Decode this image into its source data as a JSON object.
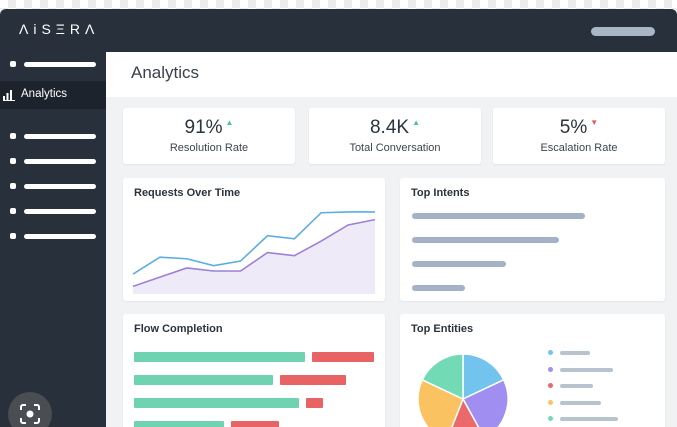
{
  "brand": {
    "logo": "ΛiSΞRΛ"
  },
  "sidebar": {
    "active_label": "Analytics",
    "icon": "bar-chart-icon"
  },
  "page": {
    "title": "Analytics"
  },
  "kpis": [
    {
      "value": "91%",
      "label": "Resolution Rate",
      "trend": "up",
      "trend_color": "#3ec7a0"
    },
    {
      "value": "8.4K",
      "label": "Total Conversation",
      "trend": "up",
      "trend_color": "#3ec7a0"
    },
    {
      "value": "5%",
      "label": "Escalation Rate",
      "trend": "down",
      "trend_color": "#e85a5a"
    }
  ],
  "cards": {
    "requests_title": "Requests Over Time",
    "intents_title": "Top Intents",
    "flow_title": "Flow Completion",
    "entities_title": "Top Entities"
  },
  "chart_data": [
    {
      "type": "line",
      "title": "Requests Over Time",
      "x": [
        1,
        2,
        3,
        4,
        5,
        6,
        7,
        8,
        9,
        10
      ],
      "series": [
        {
          "color": "#5aaee0",
          "values": [
            26,
            48,
            46,
            37,
            43,
            76,
            72,
            106,
            107,
            107
          ]
        },
        {
          "color": "#9c80d8",
          "values": [
            10,
            22,
            34,
            30,
            30,
            54,
            50,
            69,
            90,
            97
          ]
        }
      ],
      "ylim": [
        0,
        120
      ],
      "area_fill": "#efeaf8"
    },
    {
      "type": "bar",
      "title": "Top Intents",
      "values": [
        173,
        147,
        94,
        53
      ],
      "color": "#a3b2c4"
    },
    {
      "type": "bar",
      "title": "Flow Completion",
      "stacked": true,
      "series": [
        {
          "color": "#6fd3b2",
          "values": [
            171,
            139,
            165,
            90
          ]
        },
        {
          "color": "#e86363",
          "values": [
            62,
            66,
            17,
            48
          ]
        }
      ]
    },
    {
      "type": "pie",
      "title": "Top Entities",
      "values": [
        18,
        24,
        14,
        26,
        18
      ],
      "colors": [
        "#72c4ef",
        "#a08ef0",
        "#ea6a6a",
        "#fbc262",
        "#72dbb5"
      ]
    }
  ]
}
